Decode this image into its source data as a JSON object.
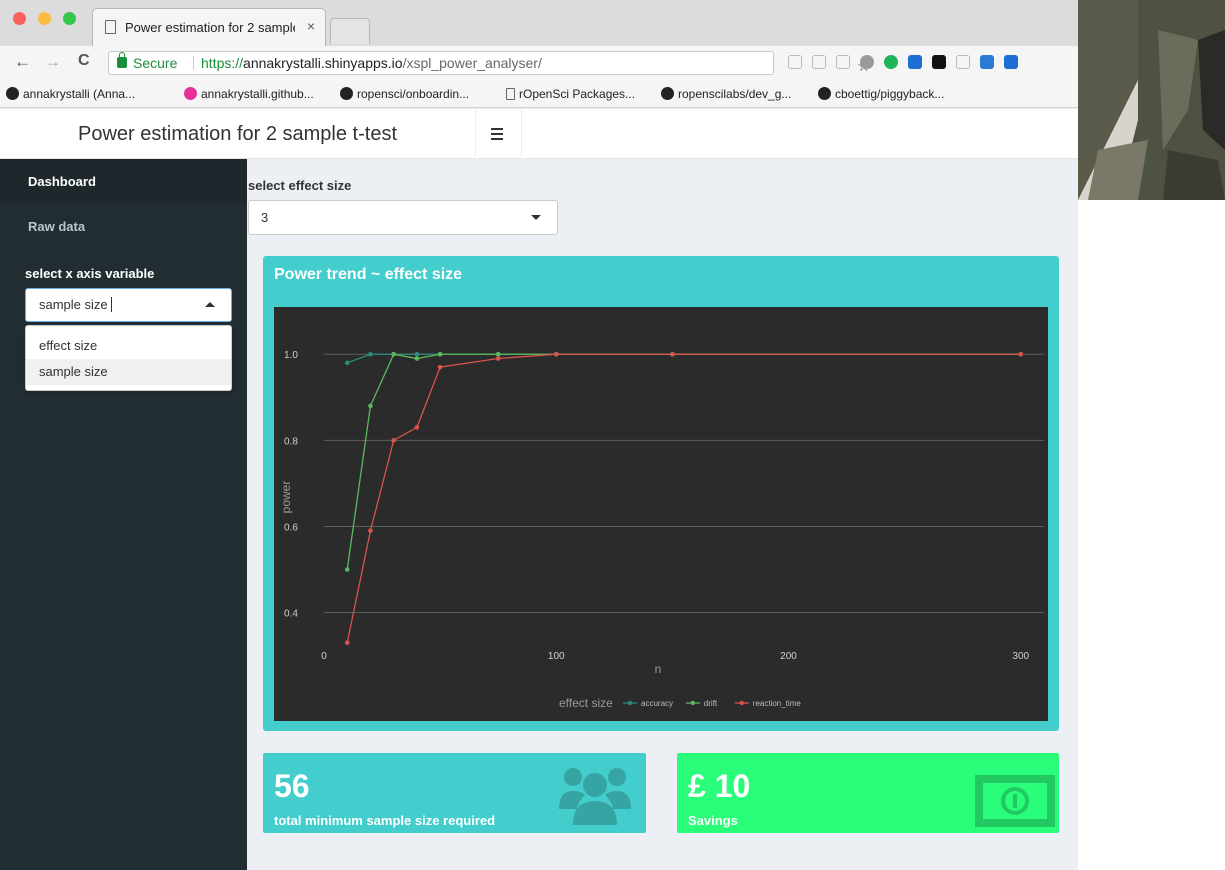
{
  "browser": {
    "tab_title": "Power estimation for 2 sample t-test",
    "tab_close": "×",
    "secure_label": "Secure",
    "url_protocol": "https://",
    "url_host": "annakrystalli.shinyapps.io",
    "url_path": "/xspl_power_analyser/",
    "nav_back": "←",
    "nav_forward": "→",
    "nav_reload": "C",
    "bookmark_star": "☆",
    "bookmarks": [
      {
        "label": "annakrystalli (Anna...",
        "icon": "github-icon"
      },
      {
        "label": "annakrystalli.github...",
        "icon": "hexo-icon"
      },
      {
        "label": "ropensci/onboardin...",
        "icon": "github-icon"
      },
      {
        "label": "rOpenSci Packages...",
        "icon": "page-icon"
      },
      {
        "label": "ropenscilabs/dev_g...",
        "icon": "github-icon"
      },
      {
        "label": "cboettig/piggyback...",
        "icon": "github-icon"
      }
    ]
  },
  "header": {
    "title": "Power estimation for 2 sample t-test"
  },
  "sidebar": {
    "items": [
      {
        "label": "Dashboard",
        "active": true
      },
      {
        "label": "Raw data",
        "active": false
      }
    ],
    "x_axis_label": "select x axis variable",
    "x_axis_value": "sample size",
    "x_axis_options": [
      "effect size",
      "sample size"
    ]
  },
  "main": {
    "effect_label": "select effect size",
    "effect_value": "3",
    "plot_title": "Power trend ~ effect size",
    "sample_box": {
      "number": "56",
      "caption": "total minimum sample size required",
      "icon": "users-icon",
      "color": "#43cdcc"
    },
    "savings_box": {
      "number": "£ 10",
      "caption": "Savings",
      "icon": "money-icon",
      "color": "#2afd79"
    }
  },
  "chart_data": {
    "type": "line",
    "xlabel": "n",
    "ylabel": "power",
    "xlim": [
      0,
      310
    ],
    "ylim": [
      0.32,
      1.04
    ],
    "xticks": [
      0,
      100,
      200,
      300
    ],
    "yticks": [
      0.4,
      0.6,
      0.8,
      1.0
    ],
    "ytick_labels": [
      "0.4",
      "0.6",
      "0.8",
      "1.0"
    ],
    "grid": true,
    "legend_title": "effect size",
    "legend_position": "bottom",
    "series": [
      {
        "name": "accuracy",
        "color": "#2e8b7a",
        "x": [
          10,
          20,
          30,
          40,
          50,
          75,
          100,
          150,
          300
        ],
        "y": [
          0.98,
          1.0,
          1.0,
          1.0,
          1.0,
          1.0,
          1.0,
          1.0,
          1.0
        ]
      },
      {
        "name": "drift",
        "color": "#5cb85c",
        "x": [
          10,
          20,
          30,
          40,
          50,
          75,
          100,
          150,
          300
        ],
        "y": [
          0.5,
          0.88,
          1.0,
          0.99,
          1.0,
          1.0,
          1.0,
          1.0,
          1.0
        ]
      },
      {
        "name": "reaction_time",
        "color": "#d9534f",
        "x": [
          10,
          20,
          30,
          40,
          50,
          75,
          100,
          150,
          300
        ],
        "y": [
          0.33,
          0.59,
          0.8,
          0.83,
          0.97,
          0.99,
          1.0,
          1.0,
          1.0
        ]
      }
    ]
  }
}
